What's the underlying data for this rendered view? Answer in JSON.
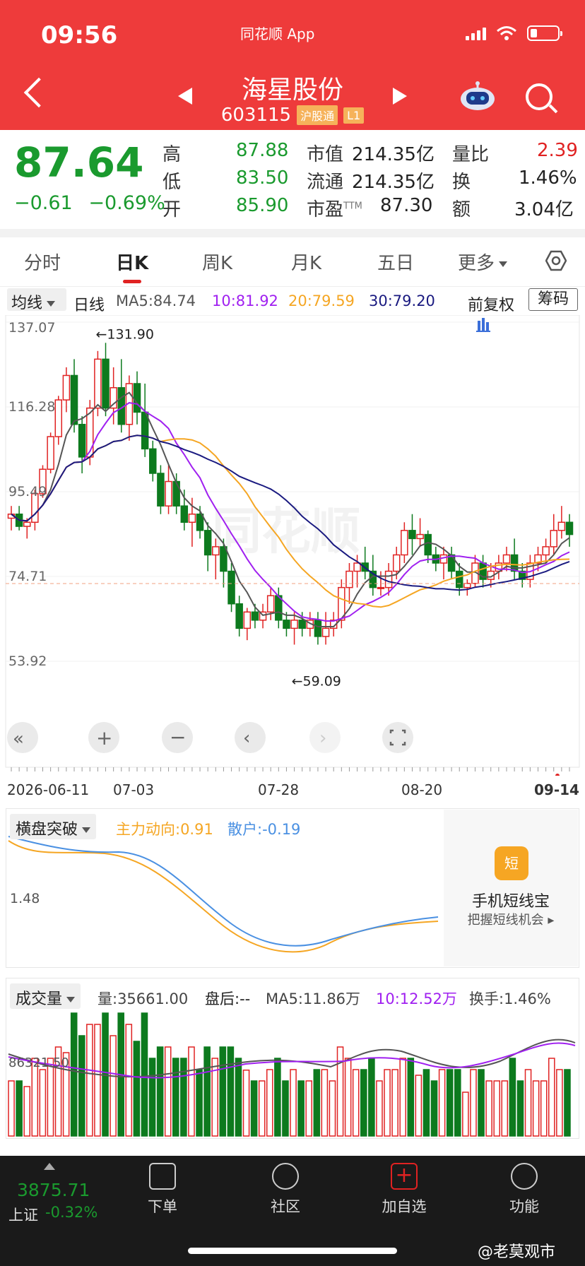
{
  "status": {
    "time": "09:56",
    "app": "同花顺 App"
  },
  "stock": {
    "name": "海星股份",
    "code": "603115",
    "tag1": "沪股通",
    "tag2": "L1"
  },
  "quote": {
    "price": "87.64",
    "change": "−0.61",
    "change_pct": "−0.69%",
    "high_label": "高",
    "high": "87.88",
    "low_label": "低",
    "low": "83.50",
    "open_label": "开",
    "open": "85.90",
    "mcap_label": "市值",
    "mcap": "214.35亿",
    "float_label": "流通",
    "float": "214.35亿",
    "pe_label": "市盈",
    "pe_sup": "TTM",
    "pe": "87.30",
    "vr_label": "量比",
    "vr": "2.39",
    "turn_label": "换",
    "turn": "1.46%",
    "amt_label": "额",
    "amt": "3.04亿"
  },
  "tabs": [
    "分时",
    "日K",
    "周K",
    "月K",
    "五日",
    "更多"
  ],
  "ma_row": {
    "dropdown": "均线",
    "period": "日线",
    "ma5": "MA5:84.74",
    "ma10": "10:81.92",
    "ma20": "20:79.59",
    "ma30": "30:79.20",
    "adjust": "前复权",
    "chip": "筹码"
  },
  "colors": {
    "up": "#e02222",
    "down": "#0d7a1e",
    "ma5": "#555555",
    "ma10": "#a020f0",
    "ma20": "#f5a623",
    "ma30": "#1a1a80"
  },
  "chart_data": {
    "type": "candlestick",
    "y_ticks": [
      "137.07",
      "116.28",
      "95.49",
      "74.71",
      "53.92"
    ],
    "ylim": [
      53.92,
      137.07
    ],
    "max_label": "←131.90",
    "min_label": "←59.09",
    "dates": [
      "2026-06-11",
      "07-03",
      "07-28",
      "08-20",
      "09-14"
    ],
    "candles": [
      [
        89,
        92,
        86,
        90
      ],
      [
        90,
        92,
        86,
        87
      ],
      [
        87,
        89,
        84,
        88
      ],
      [
        88,
        96,
        86,
        95
      ],
      [
        95,
        102,
        94,
        101
      ],
      [
        101,
        110,
        100,
        109
      ],
      [
        109,
        119,
        107,
        118
      ],
      [
        118,
        126,
        115,
        124
      ],
      [
        124,
        128,
        110,
        112
      ],
      [
        112,
        114,
        100,
        104
      ],
      [
        104,
        118,
        102,
        116
      ],
      [
        116,
        130,
        114,
        128
      ],
      [
        128,
        132,
        114,
        116
      ],
      [
        116,
        126,
        112,
        121
      ],
      [
        121,
        128,
        110,
        112
      ],
      [
        112,
        124,
        108,
        122
      ],
      [
        122,
        125,
        112,
        115
      ],
      [
        115,
        122,
        104,
        106
      ],
      [
        106,
        108,
        98,
        100
      ],
      [
        100,
        102,
        90,
        92
      ],
      [
        92,
        102,
        90,
        98
      ],
      [
        98,
        100,
        90,
        92
      ],
      [
        92,
        96,
        86,
        88
      ],
      [
        88,
        94,
        82,
        90
      ],
      [
        90,
        92,
        84,
        86
      ],
      [
        86,
        88,
        76,
        80
      ],
      [
        80,
        84,
        74,
        82
      ],
      [
        82,
        84,
        72,
        76
      ],
      [
        76,
        78,
        66,
        68
      ],
      [
        68,
        70,
        60,
        62
      ],
      [
        62,
        67,
        59.09,
        66
      ],
      [
        66,
        68,
        62,
        64
      ],
      [
        64,
        68,
        62,
        66
      ],
      [
        66,
        72,
        64,
        70
      ],
      [
        70,
        72,
        62,
        64
      ],
      [
        64,
        66,
        60,
        62
      ],
      [
        62,
        66,
        58,
        64
      ],
      [
        64,
        66,
        60,
        62
      ],
      [
        62,
        66,
        60,
        64
      ],
      [
        64,
        66,
        58,
        60
      ],
      [
        60,
        66,
        58,
        62
      ],
      [
        62,
        66,
        60,
        64
      ],
      [
        64,
        74,
        62,
        72
      ],
      [
        72,
        78,
        68,
        76
      ],
      [
        76,
        80,
        72,
        78
      ],
      [
        78,
        82,
        74,
        76
      ],
      [
        76,
        80,
        70,
        72
      ],
      [
        72,
        76,
        70,
        72
      ],
      [
        72,
        78,
        70,
        76
      ],
      [
        76,
        82,
        74,
        80
      ],
      [
        80,
        88,
        78,
        86
      ],
      [
        86,
        90,
        80,
        84
      ],
      [
        84,
        89,
        82,
        85
      ],
      [
        85,
        86,
        78,
        80
      ],
      [
        80,
        82,
        76,
        78
      ],
      [
        78,
        82,
        74,
        80
      ],
      [
        80,
        82,
        74,
        76
      ],
      [
        76,
        78,
        70,
        72
      ],
      [
        72,
        74,
        70,
        73
      ],
      [
        73,
        80,
        72,
        78
      ],
      [
        78,
        80,
        72,
        74
      ],
      [
        74,
        78,
        72,
        76
      ],
      [
        76,
        80,
        74,
        78
      ],
      [
        78,
        82,
        76,
        80
      ],
      [
        80,
        84,
        74,
        76
      ],
      [
        76,
        78,
        72,
        74
      ],
      [
        74,
        80,
        72,
        78
      ],
      [
        78,
        82,
        76,
        80
      ],
      [
        80,
        84,
        78,
        82
      ],
      [
        82,
        90,
        80,
        86
      ],
      [
        86,
        92,
        84,
        88
      ],
      [
        88,
        90,
        82,
        85
      ]
    ]
  },
  "indicator": {
    "dropdown": "横盘突破",
    "main": "主力动向:0.91",
    "retail": "散户:-0.19",
    "tick": "1.48"
  },
  "ad": {
    "icon": "短",
    "title": "手机短线宝",
    "sub": "把握短线机会"
  },
  "volume": {
    "dropdown": "成交量",
    "vol": "量:35661.00",
    "after": "盘后:--",
    "ma5": "MA5:11.86万",
    "ma10": "10:12.52万",
    "turnover": "换手:1.46%",
    "tick": "86321.50"
  },
  "bottom": {
    "index_value": "3875.71",
    "index_name": "上证",
    "index_change": "-0.32%",
    "nav": [
      "下单",
      "社区",
      "加自选",
      "功能"
    ],
    "watermark": "@老莫观市"
  }
}
